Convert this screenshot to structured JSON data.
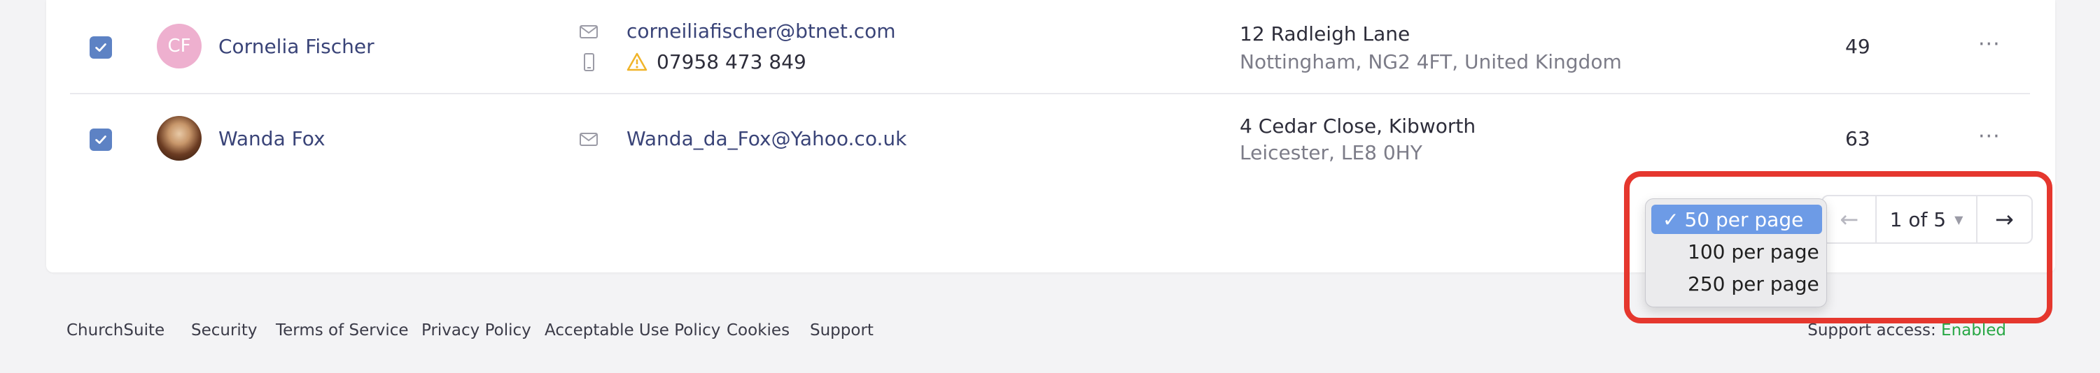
{
  "people": [
    {
      "initials": "CF",
      "name": "Cornelia Fischer",
      "email": "corneiliafischer@btnet.com",
      "phone": "07958 473 849",
      "phone_warning": true,
      "address_line1": "12 Radleigh Lane",
      "address_line2": "Nottingham, NG2 4FT, United Kingdom",
      "age": "49",
      "checked": true
    },
    {
      "initials": "",
      "name": "Wanda Fox",
      "email": "Wanda_da_Fox@Yahoo.co.uk",
      "address_line1": "4 Cedar Close, Kibworth",
      "address_line2": "Leicester, LE8 0HY",
      "age": "63",
      "checked": true
    }
  ],
  "row_actions_label": "···",
  "per_page": {
    "options": [
      "50 per page",
      "100 per page",
      "250 per page"
    ],
    "selected_index": 0,
    "check_mark": "✓"
  },
  "pagination": {
    "prev_glyph": "←",
    "page_info": "1 of 5",
    "next_glyph": "→"
  },
  "footer": {
    "links": [
      "ChurchSuite",
      "Security",
      "Terms of Service",
      "Privacy Policy",
      "Acceptable Use Policy",
      "Cookies",
      "Support"
    ],
    "support_access_label": "Support access:",
    "support_access_status": "Enabled"
  },
  "colors": {
    "accent": "#5d82c4",
    "highlight": "#e5372e",
    "enabled": "#28a745"
  }
}
